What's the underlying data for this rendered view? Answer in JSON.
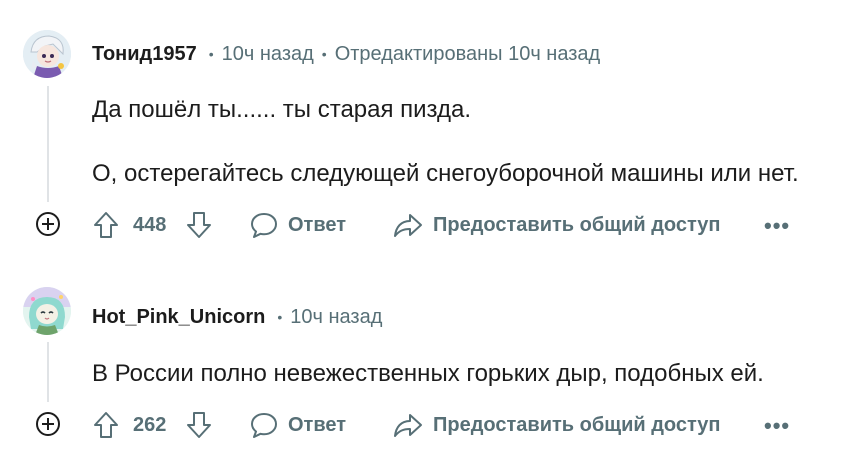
{
  "comments": [
    {
      "author": "Тонид1957",
      "time": "10ч назад",
      "edited": "Отредактированы 10ч назад",
      "paragraphs": [
        "Да пошёл ты...... ты старая пизда.",
        "О, остерегайтесь следующей снегоуборочной машины или нет."
      ],
      "score": "448",
      "reply_label": "Ответ",
      "share_label": "Предоставить общий доступ",
      "more_label": "•••"
    },
    {
      "author": "Hot_Pink_Unicorn",
      "time": "10ч назад",
      "paragraphs": [
        "В России полно невежественных горьких дыр, подобных ей."
      ],
      "score": "262",
      "reply_label": "Ответ",
      "share_label": "Предоставить общий доступ",
      "more_label": "•••"
    }
  ],
  "icons": {
    "expand": "plus-circle-icon",
    "upvote": "arrow-up-icon",
    "downvote": "arrow-down-icon",
    "reply": "speech-bubble-icon",
    "share": "share-arrow-icon"
  },
  "colors": {
    "meta": "#576f76",
    "text": "#1c1c1c",
    "thread_line": "#e0e3e6"
  }
}
